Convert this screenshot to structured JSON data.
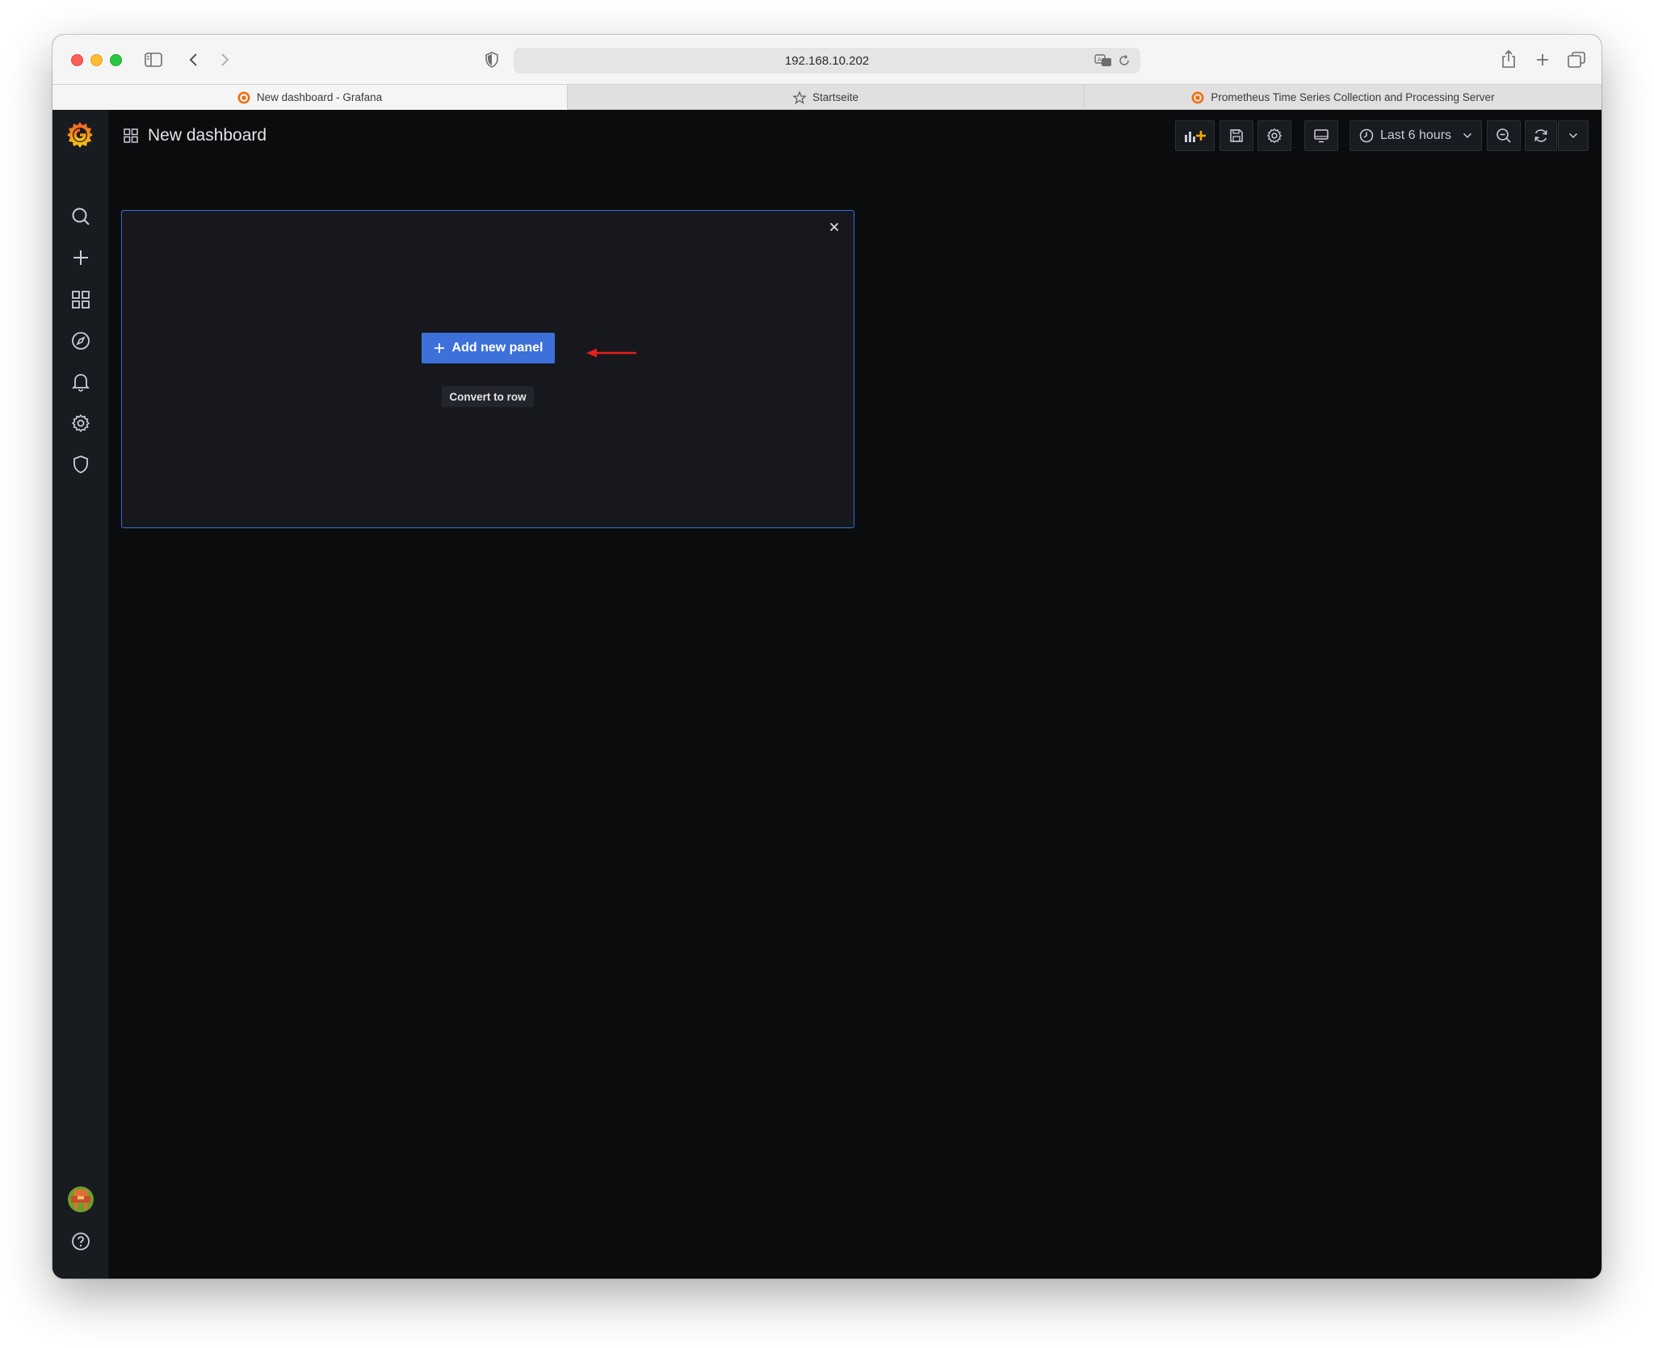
{
  "browser": {
    "url": "192.168.10.202",
    "tabs": [
      {
        "label": "New dashboard - Grafana",
        "active": true
      },
      {
        "label": "Startseite",
        "active": false
      },
      {
        "label": "Prometheus Time Series Collection and Processing Server",
        "active": false
      }
    ]
  },
  "header": {
    "title": "New dashboard",
    "time_range": "Last 6 hours"
  },
  "panel": {
    "add_new_panel_label": "Add new panel",
    "convert_to_row_label": "Convert to row",
    "close_glyph": "×"
  },
  "sidebar": {
    "items": [
      "search-icon",
      "plus-icon",
      "dashboards-icon",
      "explore-icon",
      "bell-icon",
      "gear-icon",
      "shield-icon"
    ]
  },
  "colors": {
    "primary_button": "#3d71d9",
    "panel_border": "#3272d9",
    "annotation_arrow": "#e8201c",
    "grafana_logo": "#f46800"
  }
}
